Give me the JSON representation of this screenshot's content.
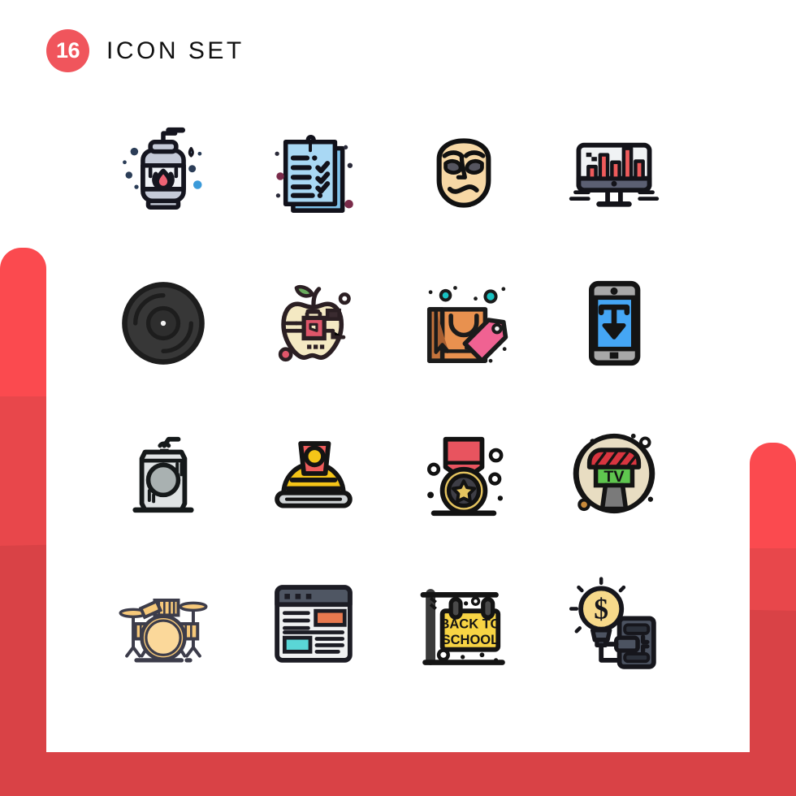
{
  "header": {
    "count": "16",
    "title": "ICON SET",
    "badge_color": "#f0555c",
    "title_color": "#111111"
  },
  "background": {
    "accent_light": "#fb4a4f",
    "accent_mid": "#e8474b",
    "accent_dark": "#d94246",
    "card_color": "#ffffff"
  },
  "grid": {
    "columns": 4,
    "rows": 4,
    "total": 16
  },
  "icons": [
    {
      "index": 1,
      "name": "soap-dispenser-icon",
      "label": "Soap Dispenser",
      "row": 1,
      "col": 1,
      "colors": [
        "#c5cad8",
        "#e8748a",
        "#1b1b25"
      ]
    },
    {
      "index": 2,
      "name": "checklist-icon",
      "label": "Checklist",
      "row": 1,
      "col": 2,
      "colors": [
        "#a9d8f4",
        "#79c0ea",
        "#111118"
      ]
    },
    {
      "index": 3,
      "name": "face-mask-icon",
      "label": "Mask",
      "row": 1,
      "col": 3,
      "colors": [
        "#f7d8a5",
        "#55555f",
        "#111111"
      ]
    },
    {
      "index": 4,
      "name": "analytics-monitor-icon",
      "label": "Analytics Monitor",
      "row": 1,
      "col": 4,
      "colors": [
        "#ef5b5b",
        "#5b5f72",
        "#f0f2f4"
      ]
    },
    {
      "index": 5,
      "name": "vinyl-record-icon",
      "label": "Vinyl Record",
      "row": 2,
      "col": 1,
      "colors": [
        "#373737",
        "#1d1d1d"
      ]
    },
    {
      "index": 6,
      "name": "smart-apple-chip-icon",
      "label": "Smart Apple Chip",
      "row": 2,
      "col": 2,
      "colors": [
        "#f4e9c3",
        "#e0566a",
        "#6aab5e",
        "#2b1f23"
      ]
    },
    {
      "index": 7,
      "name": "shopping-bag-tag-icon",
      "label": "Shopping Bag Tag",
      "row": 2,
      "col": 3,
      "colors": [
        "#e8914f",
        "#f06292",
        "#19c2c2",
        "#1b1b1b"
      ]
    },
    {
      "index": 8,
      "name": "mobile-download-icon",
      "label": "Mobile Download",
      "row": 2,
      "col": 4,
      "colors": [
        "#45a6f5",
        "#a8a8a8",
        "#141414"
      ]
    },
    {
      "index": 9,
      "name": "soda-can-icon",
      "label": "Soda Can",
      "row": 3,
      "col": 1,
      "colors": [
        "#dfe3e4",
        "#a9b1b1",
        "#15191a"
      ]
    },
    {
      "index": 10,
      "name": "conductor-cap-icon",
      "label": "Cap With Badge",
      "row": 3,
      "col": 2,
      "colors": [
        "#f5c518",
        "#ef5b5b",
        "#d0d4d6",
        "#141414"
      ]
    },
    {
      "index": 11,
      "name": "award-medal-icon",
      "label": "Award Medal",
      "row": 3,
      "col": 3,
      "colors": [
        "#e8545f",
        "#e5c45f",
        "#3e3e46",
        "#121212"
      ]
    },
    {
      "index": 12,
      "name": "tv-microphone-icon",
      "label": "TV Microphone",
      "row": 3,
      "col": 4,
      "colors": [
        "#e8ddc2",
        "#d8353f",
        "#5fc64f",
        "#7a7a7a"
      ]
    },
    {
      "index": 13,
      "name": "drum-set-icon",
      "label": "Drum Set",
      "row": 4,
      "col": 1,
      "colors": [
        "#f7c97a",
        "#3c3c4a"
      ]
    },
    {
      "index": 14,
      "name": "browser-window-icon",
      "label": "Browser Window",
      "row": 4,
      "col": 2,
      "colors": [
        "#4f5663",
        "#e8794f",
        "#5ad6d6",
        "#f0f1f2"
      ]
    },
    {
      "index": 15,
      "name": "back-to-school-sign-icon",
      "label": "Back To School Sign",
      "row": 4,
      "col": 3,
      "colors": [
        "#f7d444",
        "#3a3a3a",
        "#141414"
      ]
    },
    {
      "index": 16,
      "name": "money-idea-plug-icon",
      "label": "Money Idea Plug",
      "row": 4,
      "col": 4,
      "colors": [
        "#f7d98a",
        "#4c5361",
        "#161616"
      ]
    }
  ],
  "icon_text": {
    "back_to_school_line1": "BACK TO",
    "back_to_school_line2": "SCHOOL",
    "tv_label": "TV",
    "dollar_symbol": "$"
  }
}
